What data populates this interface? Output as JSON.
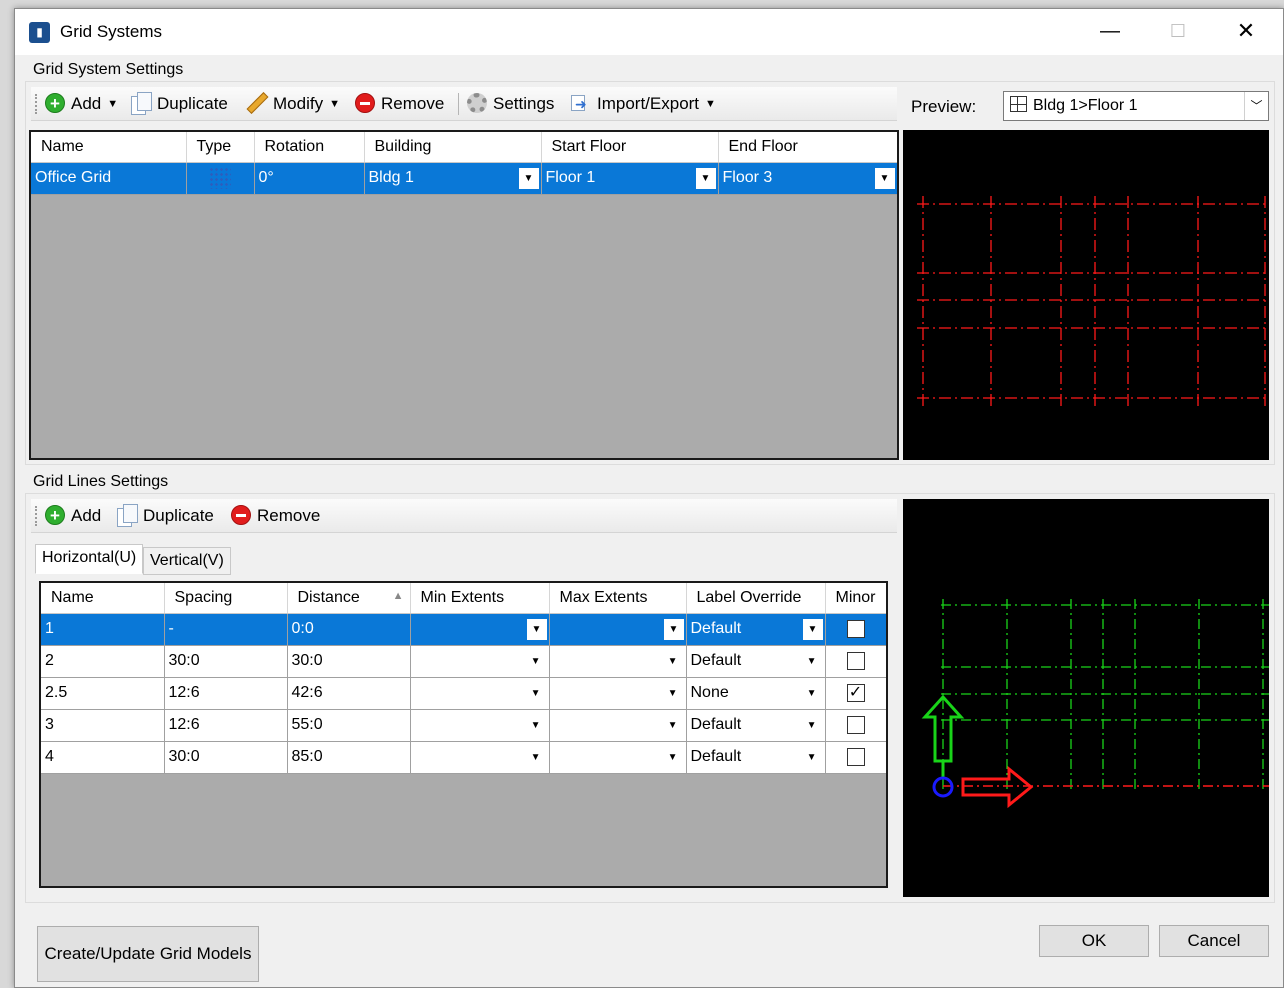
{
  "window": {
    "title": "Grid Systems",
    "minimize": "—",
    "maximize": "☐",
    "close": "✕"
  },
  "system_settings": {
    "group_label": "Grid System Settings",
    "toolbar": {
      "add": "Add",
      "duplicate": "Duplicate",
      "modify": "Modify",
      "remove": "Remove",
      "settings": "Settings",
      "import_export": "Import/Export"
    },
    "columns": [
      "Name",
      "Type",
      "Rotation",
      "Building",
      "Start Floor",
      "End Floor"
    ],
    "rows": [
      {
        "name": "Office Grid",
        "type": "grid-icon",
        "rotation": "0°",
        "building": "Bldg 1",
        "start_floor": "Floor 1",
        "end_floor": "Floor 3",
        "selected": true
      }
    ],
    "preview_label": "Preview:",
    "preview_value": "Bldg 1>Floor 1"
  },
  "lines_settings": {
    "group_label": "Grid Lines Settings",
    "toolbar": {
      "add": "Add",
      "duplicate": "Duplicate",
      "remove": "Remove"
    },
    "tabs": [
      {
        "label": "Horizontal(U)",
        "active": true
      },
      {
        "label": "Vertical(V)",
        "active": false
      }
    ],
    "columns": [
      "Name",
      "Spacing",
      "Distance",
      "Min Extents",
      "Max Extents",
      "Label Override",
      "Minor"
    ],
    "sort_indicator": "▲",
    "rows": [
      {
        "name": "1",
        "spacing": "-",
        "distance": "0:0",
        "min_extents": "",
        "max_extents": "",
        "label_override": "Default",
        "minor": false,
        "selected": true
      },
      {
        "name": "2",
        "spacing": "30:0",
        "distance": "30:0",
        "min_extents": "",
        "max_extents": "",
        "label_override": "Default",
        "minor": false,
        "selected": false
      },
      {
        "name": "2.5",
        "spacing": "12:6",
        "distance": "42:6",
        "min_extents": "",
        "max_extents": "",
        "label_override": "None",
        "minor": true,
        "selected": false
      },
      {
        "name": "3",
        "spacing": "12:6",
        "distance": "55:0",
        "min_extents": "",
        "max_extents": "",
        "label_override": "Default",
        "minor": false,
        "selected": false
      },
      {
        "name": "4",
        "spacing": "30:0",
        "distance": "85:0",
        "min_extents": "",
        "max_extents": "",
        "label_override": "Default",
        "minor": false,
        "selected": false
      }
    ]
  },
  "buttons": {
    "create_update": "Create/Update Grid Models",
    "ok": "OK",
    "cancel": "Cancel"
  },
  "colors": {
    "selection": "#0a78d7",
    "grid_red": "#ff1a1a",
    "grid_green": "#19d419",
    "axis_blue": "#1a1aff"
  },
  "icons": {
    "checkmark": "✓",
    "dropdown": "▼"
  }
}
